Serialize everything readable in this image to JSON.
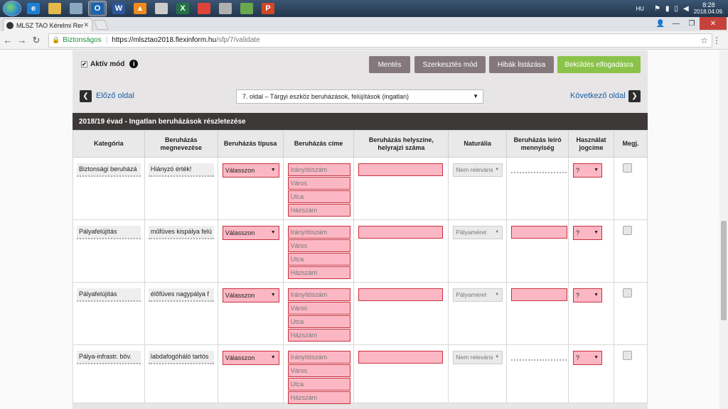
{
  "taskbar": {
    "icons": [
      {
        "name": "ie-icon",
        "label": "e",
        "color": "#1f7fd0"
      },
      {
        "name": "folder-icon",
        "label": "",
        "color": "#e4b84a"
      },
      {
        "name": "calculator-icon",
        "label": "",
        "color": "#8aa6c0"
      },
      {
        "name": "outlook-icon",
        "label": "O",
        "color": "#1b64b0"
      },
      {
        "name": "word-icon",
        "label": "W",
        "color": "#2b579a"
      },
      {
        "name": "vlc-icon",
        "label": "▲",
        "color": "#f08a1c"
      },
      {
        "name": "spreadsheet-icon",
        "label": "",
        "color": "#cccccc"
      },
      {
        "name": "excel-icon",
        "label": "X",
        "color": "#217346"
      },
      {
        "name": "chrome-icon",
        "label": "",
        "color": "#db4437"
      },
      {
        "name": "snipping-icon",
        "label": "",
        "color": "#b0b0b0"
      },
      {
        "name": "pen-icon",
        "label": "",
        "color": "#6aa84f"
      },
      {
        "name": "powerpoint-icon",
        "label": "P",
        "color": "#d24726"
      }
    ],
    "lang": "HU",
    "time": "8:28",
    "date": "2018.04.09."
  },
  "browser": {
    "tab_title": "MLSZ TAO Kérelmi Rend",
    "secure_label": "Biztonságos",
    "url_host": "https://mlsztao2018.flexinform.hu",
    "url_path": "/sfp/7/validate"
  },
  "toolbar": {
    "active_mode_label": "Aktív mód",
    "save_label": "Mentés",
    "edit_mode_label": "Szerkesztés mód",
    "list_errors_label": "Hibák listázása",
    "submit_label": "Beküldés elfogadásra"
  },
  "pager": {
    "prev_label": "Előző oldal",
    "next_label": "Következő oldal",
    "current_page": "7. oldal – Tárgyi eszköz beruházások, felújítások (ingatlan)"
  },
  "section_title": "2018/19 évad - Ingatlan beruházások részletezése",
  "table": {
    "headers": [
      "Kategória",
      "Beruházás megnevezése",
      "Beruházás típusa",
      "Beruházás címe",
      "Beruházás helyszíne, helyrajzi száma",
      "Naturália",
      "Beruházás leíró mennyiség",
      "Használat jogcíme",
      "Megj."
    ],
    "address_placeholders": [
      "Irányítószám",
      "Város",
      "Utca",
      "Házszám"
    ],
    "select_placeholder": "Válasszon",
    "usage_placeholder": "?",
    "rows": [
      {
        "category": "Biztonsági beruházá",
        "name": "Hiányzó érték!",
        "naturalia": "Nem releváns"
      },
      {
        "category": "Pályafelújítás",
        "name": "műfüves kispálya felú",
        "naturalia": "Pályaméret"
      },
      {
        "category": "Pályafelújítás",
        "name": "élőfüves nagypálya f",
        "naturalia": "Pályaméret"
      },
      {
        "category": "Pálya-infrastr. böv.",
        "name": "labdafogóháló tartós",
        "naturalia": "Nem releváns"
      }
    ]
  }
}
